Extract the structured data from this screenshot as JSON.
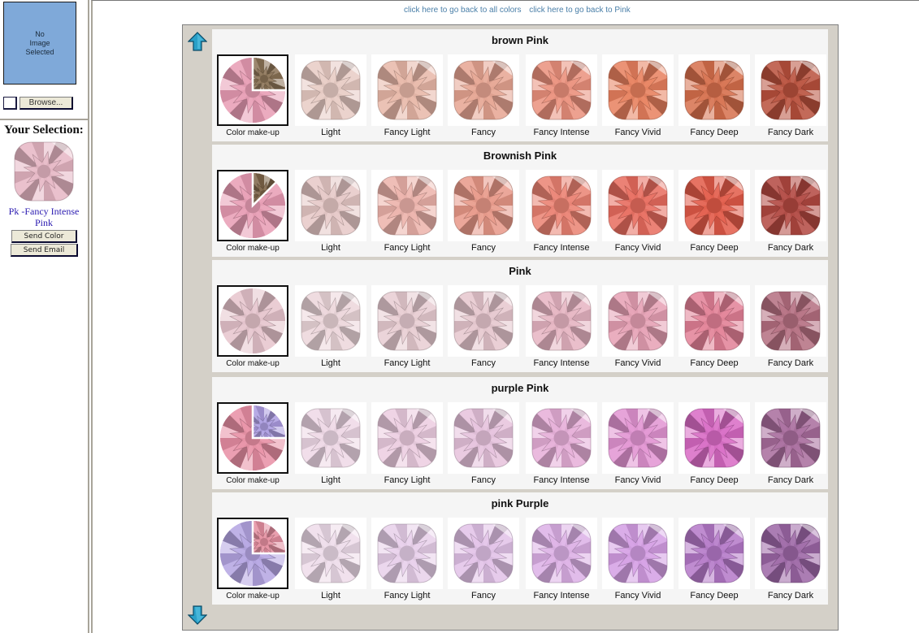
{
  "sidebar": {
    "preview": {
      "lines": [
        "No",
        "Image",
        "Selected"
      ]
    },
    "browse_label": "Browse...",
    "selection_title": "Your Selection:",
    "selection_name": "Pk -Fancy Intense Pink",
    "selection_color": "#e6b6c4",
    "send_color_label": "Send Color",
    "send_email_label": "Send Email"
  },
  "header": {
    "links": [
      "click here to go back to all colors",
      "click here to go back to Pink"
    ]
  },
  "gallery": {
    "scroll_up": "arrow-up-icon",
    "scroll_down": "arrow-down-icon",
    "makeup_label": "Color make-up",
    "sections": [
      {
        "title": "brown Pink",
        "makeup": {
          "main": "#e89cb4",
          "secondary": "#8a7256",
          "secondary_fraction": 0.25
        },
        "tiles": [
          {
            "label": "Light",
            "color": "#e8cbc4"
          },
          {
            "label": "Fancy Light",
            "color": "#e8b7a8"
          },
          {
            "label": "Fancy",
            "color": "#e6a492"
          },
          {
            "label": "Fancy Intense",
            "color": "#ea907c"
          },
          {
            "label": "Fancy Vivid",
            "color": "#e8805e"
          },
          {
            "label": "Fancy Deep",
            "color": "#d66f4c"
          },
          {
            "label": "Fancy Dark",
            "color": "#b8503c"
          }
        ]
      },
      {
        "title": "Brownish Pink",
        "makeup": {
          "main": "#e89cb4",
          "secondary": "#7c6448",
          "secondary_fraction": 0.125
        },
        "tiles": [
          {
            "label": "Light",
            "color": "#e6c8c6"
          },
          {
            "label": "Fancy Light",
            "color": "#ecb2aa"
          },
          {
            "label": "Fancy",
            "color": "#e89888"
          },
          {
            "label": "Fancy Intense",
            "color": "#ea8272"
          },
          {
            "label": "Fancy Vivid",
            "color": "#e86c5e"
          },
          {
            "label": "Fancy Deep",
            "color": "#e25a48"
          },
          {
            "label": "Fancy Dark",
            "color": "#b24840"
          }
        ]
      },
      {
        "title": "Pink",
        "makeup": {
          "main": "#e6c4cc",
          "secondary": "#e6c4cc",
          "secondary_fraction": 0
        },
        "tiles": [
          {
            "label": "Light",
            "color": "#ecd6da"
          },
          {
            "label": "Fancy Light",
            "color": "#e8ccd2"
          },
          {
            "label": "Fancy",
            "color": "#e6c6ce"
          },
          {
            "label": "Fancy Intense",
            "color": "#e6b4c2"
          },
          {
            "label": "Fancy Vivid",
            "color": "#e6a0b4"
          },
          {
            "label": "Fancy Deep",
            "color": "#e28096"
          },
          {
            "label": "Fancy Dark",
            "color": "#b46e80"
          }
        ]
      },
      {
        "title": "purple Pink",
        "makeup": {
          "main": "#e88ea4",
          "secondary": "#ac9ce0",
          "secondary_fraction": 0.25
        },
        "tiles": [
          {
            "label": "Light",
            "color": "#eed8e6"
          },
          {
            "label": "Fancy Light",
            "color": "#eccce0"
          },
          {
            "label": "Fancy",
            "color": "#e6c2dc"
          },
          {
            "label": "Fancy Intense",
            "color": "#e6aed8"
          },
          {
            "label": "Fancy Vivid",
            "color": "#e294d2"
          },
          {
            "label": "Fancy Deep",
            "color": "#d86ac4"
          },
          {
            "label": "Fancy Dark",
            "color": "#a86c9c"
          }
        ]
      },
      {
        "title": "pink Purple",
        "makeup": {
          "main": "#b4a4e2",
          "secondary": "#e48ea0",
          "secondary_fraction": 0.25
        },
        "tiles": [
          {
            "label": "Light",
            "color": "#eedcea"
          },
          {
            "label": "Fancy Light",
            "color": "#e8d0ea"
          },
          {
            "label": "Fancy",
            "color": "#e2c2e8"
          },
          {
            "label": "Fancy Intense",
            "color": "#dcb0e6"
          },
          {
            "label": "Fancy Vivid",
            "color": "#d49ee4"
          },
          {
            "label": "Fancy Deep",
            "color": "#b478c8"
          },
          {
            "label": "Fancy Dark",
            "color": "#9c66a6"
          }
        ]
      }
    ]
  }
}
